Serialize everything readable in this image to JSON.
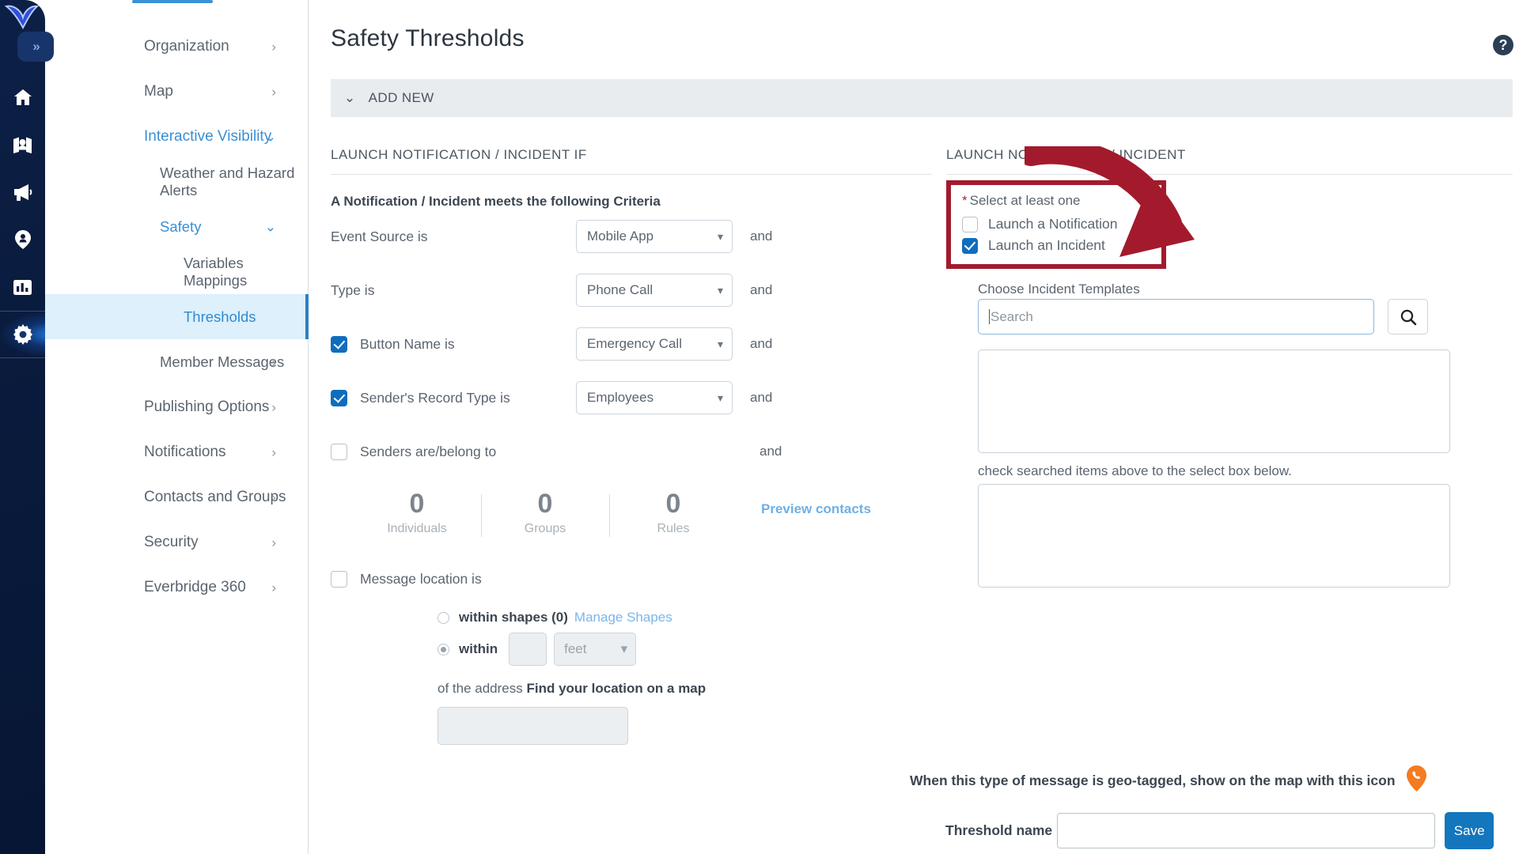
{
  "rail": {
    "logo_icon": "everbridge-logo-icon",
    "expand_icon": "chevron-double-right-icon",
    "expand_label": "»",
    "items": [
      {
        "icon": "home-icon",
        "name": "home"
      },
      {
        "icon": "map-user-icon",
        "name": "map"
      },
      {
        "icon": "megaphone-icon",
        "name": "notifications"
      },
      {
        "icon": "location-pin-person-icon",
        "name": "locations"
      },
      {
        "icon": "bar-chart-icon",
        "name": "reports"
      },
      {
        "icon": "gear-icon",
        "name": "settings",
        "active": true
      }
    ]
  },
  "nav": {
    "items": [
      {
        "label": "Organization",
        "level": 1,
        "chevron": "right",
        "state": ""
      },
      {
        "label": "Map",
        "level": 1,
        "chevron": "right",
        "state": ""
      },
      {
        "label": "Interactive Visibility",
        "level": 1,
        "chevron": "down",
        "state": "blue"
      },
      {
        "label": "Weather and Hazard Alerts",
        "level": 2,
        "chevron": "",
        "state": ""
      },
      {
        "label": "Safety",
        "level": 2,
        "chevron": "down",
        "state": "blue"
      },
      {
        "label": "Variables Mappings",
        "level": 3,
        "chevron": "",
        "state": ""
      },
      {
        "label": "Thresholds",
        "level": 3,
        "chevron": "",
        "state": "sel"
      },
      {
        "label": "Member Messages",
        "level": 2,
        "chevron": "right",
        "state": ""
      },
      {
        "label": "Publishing Options",
        "level": 1,
        "chevron": "right",
        "state": ""
      },
      {
        "label": "Notifications",
        "level": 1,
        "chevron": "right",
        "state": ""
      },
      {
        "label": "Contacts and Groups",
        "level": 1,
        "chevron": "right",
        "state": ""
      },
      {
        "label": "Security",
        "level": 1,
        "chevron": "right",
        "state": ""
      },
      {
        "label": "Everbridge 360",
        "level": 1,
        "chevron": "right",
        "state": ""
      }
    ]
  },
  "header": {
    "title": "Safety Thresholds",
    "help_icon": "question-mark-help-icon",
    "help_label": "?"
  },
  "add_new": {
    "label": "ADD NEW",
    "caret": "⌄",
    "caret_icon": "chevron-down-icon"
  },
  "left_panel": {
    "section_title": "LAUNCH NOTIFICATION / INCIDENT IF",
    "subtitle": "A Notification / Incident meets the following Criteria",
    "criteria": [
      {
        "label": "Event Source is",
        "has_checkbox": false,
        "checked": false,
        "value": "Mobile App",
        "and": "and"
      },
      {
        "label": "Type is",
        "has_checkbox": false,
        "checked": false,
        "value": "Phone Call",
        "and": "and"
      },
      {
        "label": "Button Name is",
        "has_checkbox": true,
        "checked": true,
        "value": "Emergency Call",
        "and": "and"
      },
      {
        "label": "Sender's Record Type is",
        "has_checkbox": true,
        "checked": true,
        "value": "Employees",
        "and": "and"
      }
    ],
    "senders_row": {
      "label": "Senders are/belong to",
      "checked": false,
      "and": "and"
    },
    "counters": [
      {
        "value": "0",
        "label": "Individuals"
      },
      {
        "value": "0",
        "label": "Groups"
      },
      {
        "value": "0",
        "label": "Rules"
      }
    ],
    "preview_link": "Preview contacts",
    "message_location": {
      "label": "Message location is",
      "checked": false
    },
    "within_shapes": {
      "label": "within shapes (0)",
      "link": "Manage Shapes",
      "selected": false
    },
    "within_distance": {
      "label": "within",
      "selected": true,
      "value": "",
      "unit_placeholder": "feet",
      "unit_caret_icon": "chevron-down-icon"
    },
    "address_line": {
      "prefix": "of the address ",
      "link": "Find your location on a map"
    },
    "address_value": ""
  },
  "right_panel": {
    "section_title": "LAUNCH NOTIFICATION / INCIDENT",
    "required_note": {
      "star": "*",
      "text": "Select at least one"
    },
    "options": [
      {
        "label": "Launch a Notification",
        "checked": false
      },
      {
        "label": "Launch an Incident",
        "checked": true
      }
    ],
    "choose_label": "Choose Incident Templates",
    "search": {
      "value": "",
      "placeholder": "Search",
      "button_icon": "search-icon"
    },
    "results_value": "",
    "hint": "check searched items above to the select box below.",
    "selected_value": ""
  },
  "footer": {
    "geo_text": "When this type of message is geo-tagged, show on the map with this icon",
    "geo_icon": "orange-map-pin-phone-icon",
    "threshold_label": "Threshold name",
    "threshold_value": "",
    "save_label": "Save"
  },
  "annotation": {
    "arrow_icon": "red-curved-arrow-annotation",
    "box_icon": "red-highlight-box-annotation"
  },
  "colors": {
    "accent_blue": "#1476bc",
    "link_blue": "#6fb0e6",
    "annotation_red": "#a31a2d",
    "rail_navy": "#0a1b3d",
    "pin_orange": "#f47b20"
  }
}
